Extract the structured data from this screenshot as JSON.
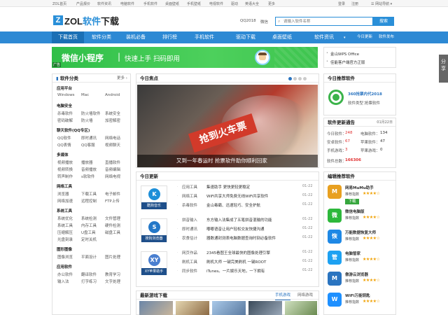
{
  "topbar": {
    "links": [
      "ZOL首页",
      "产品报价",
      "软件资讯",
      "电脑软件",
      "手机软件",
      "桌面壁纸",
      "手机壁纸",
      "电视软件",
      "驱动",
      "英语大全",
      "更多"
    ],
    "right": [
      "登录",
      "注册"
    ],
    "nav_menu": "网站导航"
  },
  "header": {
    "logo_letter": "Z",
    "logo_main": "ZOL",
    "logo_soft": "软件",
    "logo_dl": "下载",
    "qq_link": "QQ2018",
    "wechat_link": "微信",
    "search_placeholder": "请输入软件名称",
    "search_button": "搜索"
  },
  "nav": {
    "items": [
      "下载首页",
      "软件分类",
      "装机必备",
      "排行榜",
      "手机软件",
      "驱动下载",
      "桌面壁纸",
      "软件资讯"
    ],
    "right": [
      "今日更新",
      "软件发布"
    ]
  },
  "banner": {
    "title": "微信小程序",
    "tagline": "快速上手 扫码即用",
    "ad": "广告"
  },
  "side_banner": {
    "lines": [
      "金山WPS Office",
      "佳能客户端官方正版"
    ]
  },
  "category": {
    "title": "软件分类",
    "more": "更多",
    "sections": [
      {
        "name": "应用平台",
        "items": [
          "Windows",
          "Mac",
          "Android"
        ]
      },
      {
        "name": "电脑安全",
        "items": [
          "杀毒软件",
          "防火墙软件",
          "系统安全",
          "密码破解",
          "防火墙",
          "加密解密"
        ]
      },
      {
        "name": "聊天软件(QQ专区)",
        "items": [
          "QQ软件",
          "即时通讯",
          "网络电话",
          "QQ表情",
          "QQ客服",
          "视频聊天"
        ]
      },
      {
        "name": "多媒体",
        "items": [
          "视频播放",
          "播放器",
          "直播软件",
          "视频转换",
          "音频播放",
          "音频编辑",
          "转声制作",
          "s软软件",
          "网络电视"
        ]
      },
      {
        "name": "网络工具",
        "items": [
          "浏览器",
          "下载工具",
          "电子邮件",
          "网络加速",
          "远程控制",
          "FTP上传"
        ]
      },
      {
        "name": "系统工具",
        "items": [
          "系统优化",
          "系统检测",
          "文件管理",
          "系统工具",
          "内存工具",
          "硬件检测",
          "压缩解压",
          "U盘工具",
          "磁盘工具",
          "光盘刻录",
          "定时关机"
        ]
      },
      {
        "name": "图形图像",
        "items": [
          "图像浏览",
          "平面设计",
          "图片处理"
        ]
      },
      {
        "name": "应用软件",
        "items": [
          "办公软件",
          "翻译软件",
          "教育学习",
          "输入法",
          "打字练习",
          "文字处理"
        ]
      }
    ]
  },
  "focus": {
    "title": "今日焦点",
    "caption": "又到一年春运时 抢票软件助你顺利回家",
    "banner_text": "抢到火车票",
    "dots": 4
  },
  "updates": {
    "title": "今日更新",
    "groups": [
      {
        "thumb_label": "酷狗音乐",
        "thumb_char": "K",
        "rows": [
          {
            "cat": "应用工具",
            "name": "集速助手 更快更轻更稳定",
            "date": "01-22"
          },
          {
            "cat": "网络工具",
            "name": "WiFi共享大师免费无线WiFi共享软件",
            "date": "01-22"
          },
          {
            "cat": "杀毒软件",
            "name": "金山毒霸、迅速轻巧、安全护航",
            "date": "01-22"
          }
        ]
      },
      {
        "thumb_label": "搜狗浏览器",
        "thumb_char": "S",
        "rows": [
          {
            "cat": "拼音输入",
            "name": "东方输入法集成了五笔拼音混输的功能",
            "date": "01-22"
          },
          {
            "cat": "即时通讯",
            "name": "嘟嘟语音让用户轻松交友快捷沟通",
            "date": "01-22"
          },
          {
            "cat": "农食估计",
            "name": "器数通封测表电脑数据查询时刻必备软件",
            "date": "01-22"
          }
        ]
      },
      {
        "thumb_label": "XY苹果助手",
        "thumb_char": "XY",
        "rows": [
          {
            "cat": "网页作品",
            "name": "2345看图王全球最快的图像处理引擎",
            "date": "01-22"
          },
          {
            "cat": "刷机工具",
            "name": "刷机大师 一键完美刷机 一键ROOT",
            "date": "01-22"
          },
          {
            "cat": "同步软件",
            "name": "iTunes。一片娱乐天地，一下拥有",
            "date": "01-22"
          }
        ]
      }
    ]
  },
  "games": {
    "title": "最新游戏下载",
    "tabs": [
      "手机游戏",
      "网络游戏"
    ]
  },
  "recommend": {
    "title": "今日推荐软件",
    "app_name": "360抢票内代2018",
    "version_label": "软件类型：",
    "version": "抢票软件"
  },
  "stats": {
    "title": "软件更新通告",
    "date": "01月22日",
    "rows": [
      {
        "l": "今日软件：",
        "lv": "248",
        "r": "电脑软件：",
        "rv": "134"
      },
      {
        "l": "安卓软件：",
        "lv": "67",
        "r": "苹果软件：",
        "rv": "47"
      },
      {
        "l": "手机游戏：",
        "lv": "3",
        "r": "苹果游戏：",
        "rv": "0"
      }
    ],
    "total_label": "软件总数：",
    "total": "166306"
  },
  "editor_picks": {
    "title": "编辑推荐软件",
    "apps": [
      {
        "name": "网易MuMu助手",
        "type": "推荐指数",
        "stars": "★★★★☆",
        "color": "#e8a020",
        "char": "M",
        "button": "下载"
      },
      {
        "name": "微信电脑版",
        "type": "推荐指数",
        "stars": "★★★★☆",
        "color": "#2db83b",
        "char": "微"
      },
      {
        "name": "万能数据恢复大师",
        "type": "推荐指数",
        "stars": "★★★★☆",
        "color": "#1e88e5",
        "char": "恢"
      },
      {
        "name": "电脑管家",
        "type": "推荐指数",
        "stars": "★★★★☆",
        "color": "#1da1f2",
        "char": "管"
      },
      {
        "name": "傲游云浏览器",
        "type": "推荐指数",
        "stars": "★★★★☆",
        "color": "#2a74c0",
        "char": "M"
      },
      {
        "name": "WiFi万能钥匙",
        "type": "推荐指数",
        "stars": "★★★★☆",
        "color": "#1e90ff",
        "char": "W"
      }
    ]
  },
  "share": {
    "label": "分享"
  }
}
